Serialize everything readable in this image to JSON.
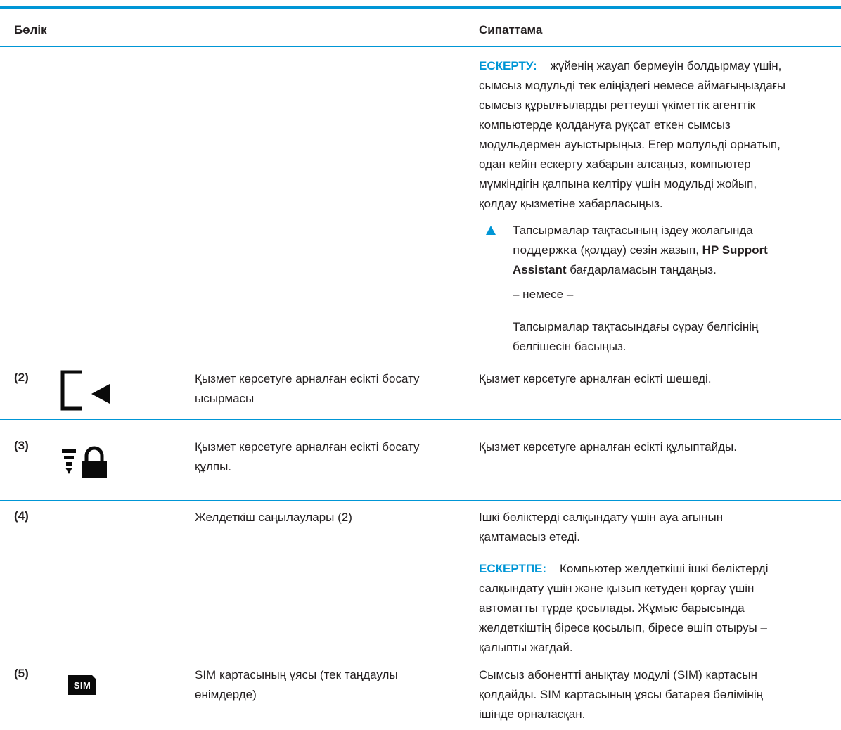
{
  "header": {
    "col_part": "Бөлік",
    "col_desc": "Сипаттама"
  },
  "cont": {
    "caution_label": "ЕСКЕРТУ:",
    "caution_l1": "жүйенің жауап бермеуін болдырмау үшін,",
    "caution_l2": "сымсыз модульді тек еліңіздегі немесе аймағыңыздағы",
    "caution_l3": "сымсыз құрылғыларды реттеуші үкіметтік агенттік",
    "caution_l4": "компьютерде қолдануға рұқсат еткен сымсыз",
    "caution_l5": "модульдермен ауыстырыңыз. Егер молульді орнатып,",
    "caution_l6": "одан кейін ескерту хабарын алсаңыз, компьютер",
    "caution_l7": "мүмкіндігін қалпына келтіру үшін модульді жойып,",
    "caution_l8": "қолдау қызметіне хабарласыңыз.",
    "step_l1": "Тапсырмалар тақтасының іздеу жолағында",
    "step_code": "поддержка",
    "step_l2_mid": " (қолдау) сөзін жазып, ",
    "step_bold1": "HP Support",
    "step_bold2": "Assistant",
    "step_l3_rest": " бағдарламасын таңдаңыз.",
    "or": "– немесе –",
    "alt_l1": "Тапсырмалар тақтасындағы сұрау белгісінің",
    "alt_l2": "белгішесін басыңыз."
  },
  "rows": [
    {
      "num": "(2)",
      "icon": "service-door-release-latch-icon",
      "part_l1": "Қызмет көрсетуге арналған есікті босату",
      "part_l2": "ысырмасы",
      "desc_l1": "Қызмет көрсетуге арналған есікті шешеді."
    },
    {
      "num": "(3)",
      "icon": "service-door-lock-icon",
      "part_l1": "Қызмет көрсетуге арналған есікті босату",
      "part_l2": "құлпы.",
      "desc_l1": "Қызмет көрсетуге арналған есікті құлыптайды."
    },
    {
      "num": "(4)",
      "part_l1": "Желдеткіш саңылаулары (2)",
      "desc_l1": "Ішкі бөліктерді салқындату үшін ауа ағынын",
      "desc_l2": "қамтамасыз етеді.",
      "note_label": "ЕСКЕРТПЕ:",
      "note_l1": "Компьютер желдеткіші ішкі бөліктерді",
      "note_l2": "салқындату үшін және қызып кетуден қорғау үшін",
      "note_l3": "автоматты түрде қосылады. Жұмыс барысында",
      "note_l4": "желдеткіштің біресе қосылып, біресе өшіп отыруы –",
      "note_l5": "қалыпты жағдай."
    },
    {
      "num": "(5)",
      "icon": "sim-icon",
      "icon_text": "SIM",
      "part_l1": "SIM картасының ұясы (тек таңдаулы",
      "part_l2": "өнімдерде)",
      "desc_l1": "Сымсыз абонентті анықтау модулі (SIM) картасын",
      "desc_l2": "қолдайды. SIM картасының ұясы батарея бөлімінің",
      "desc_l3": "ішінде орналасқан."
    }
  ]
}
